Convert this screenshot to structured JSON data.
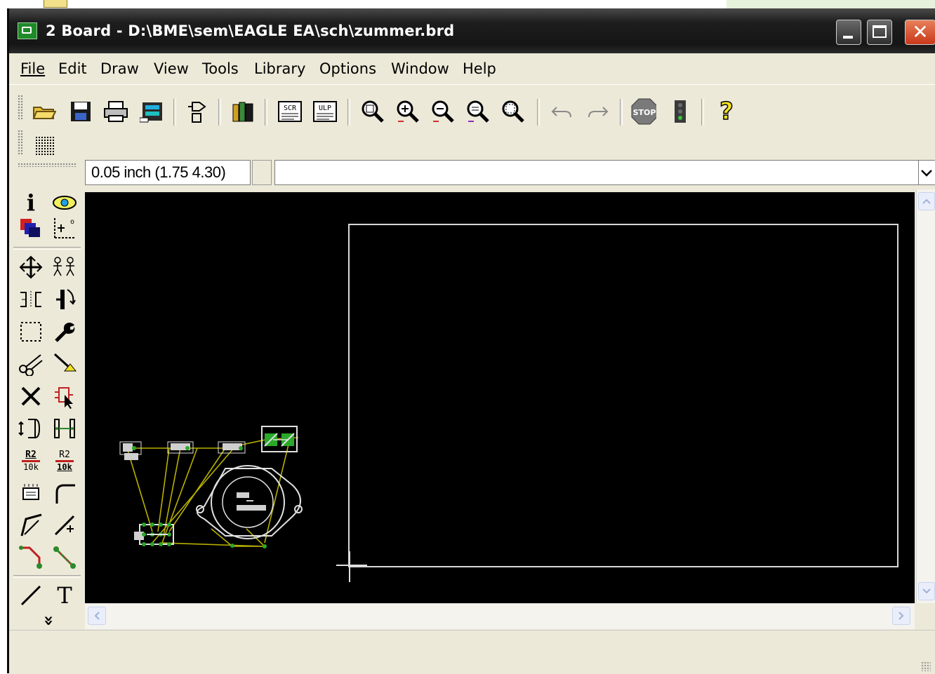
{
  "window": {
    "title": "2 Board - D:\\BME\\sem\\EAGLE EA\\sch\\zummer.brd",
    "close_glyph": "✕"
  },
  "menu": {
    "items": [
      "File",
      "Edit",
      "Draw",
      "View",
      "Tools",
      "Library",
      "Options",
      "Window",
      "Help"
    ]
  },
  "toolbar": {
    "icons": [
      "open-icon",
      "save-icon",
      "print-icon",
      "cam-processor-icon",
      "schematic-switch-icon",
      "library-books-icon",
      "script-scr-icon",
      "ulp-run-icon",
      "zoom-fit-icon",
      "zoom-in-icon",
      "zoom-out-icon",
      "zoom-redraw-icon",
      "zoom-select-icon",
      "undo-icon",
      "redo-icon",
      "stop-icon",
      "go-icon",
      "help-icon",
      "grid-icon"
    ],
    "scr_label": "SCR",
    "ulp_label": "ULP",
    "stop_label": "STOP",
    "help_label": "?"
  },
  "coord": {
    "value": "0.05 inch (1.75 4.30)",
    "command_value": ""
  },
  "tools": {
    "info_label": "i",
    "text_label": "T",
    "value_label_top": "R2",
    "value_label_bottom": "10k",
    "more_label": "»"
  },
  "colors": {
    "canvas_bg": "#000000",
    "board_outline": "#d8d8d8",
    "airwire": "#b8b000",
    "pad_green": "#2aa82a",
    "title_bar": "#1e1e1e",
    "close_red": "#d9532e"
  }
}
